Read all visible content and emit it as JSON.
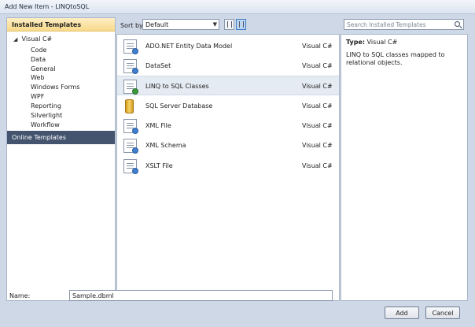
{
  "window": {
    "title": "Add New Item - LINQtoSQL"
  },
  "left_pane": {
    "header": "Installed Templates",
    "root": "Visual C#",
    "items": [
      "Code",
      "Data",
      "General",
      "Web",
      "Windows Forms",
      "WPF",
      "Reporting",
      "Silverlight",
      "Workflow"
    ],
    "online": "Online Templates"
  },
  "toolbar": {
    "sort_label": "Sort by:",
    "sort_value": "Default"
  },
  "search": {
    "placeholder": "Search Installed Templates"
  },
  "templates": [
    {
      "name": "ADO.NET Entity Data Model",
      "lang": "Visual C#",
      "icon": "entity-model-icon"
    },
    {
      "name": "DataSet",
      "lang": "Visual C#",
      "icon": "dataset-icon"
    },
    {
      "name": "LINQ to SQL Classes",
      "lang": "Visual C#",
      "icon": "linq-to-sql-icon",
      "selected": true
    },
    {
      "name": "SQL Server Database",
      "lang": "Visual C#",
      "icon": "database-icon"
    },
    {
      "name": "XML File",
      "lang": "Visual C#",
      "icon": "xml-file-icon"
    },
    {
      "name": "XML Schema",
      "lang": "Visual C#",
      "icon": "xml-schema-icon"
    },
    {
      "name": "XSLT File",
      "lang": "Visual C#",
      "icon": "xslt-file-icon"
    }
  ],
  "info": {
    "type_label": "Type:",
    "type_value": "Visual C#",
    "description": "LINQ to SQL classes mapped to relational objects."
  },
  "name_field": {
    "label": "Name:",
    "value": "Sample.dbml"
  },
  "buttons": {
    "add": "Add",
    "cancel": "Cancel"
  }
}
